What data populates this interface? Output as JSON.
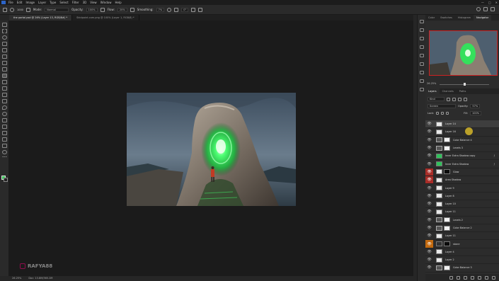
{
  "app": {
    "menu": [
      "File",
      "Edit",
      "Image",
      "Layer",
      "Type",
      "Select",
      "Filter",
      "3D",
      "View",
      "Window",
      "Help"
    ],
    "window_controls": [
      "—",
      "□",
      "✕"
    ]
  },
  "options": {
    "brush_size": "1000",
    "mode_label": "Mode:",
    "mode_value": "Normal",
    "opacity_label": "Opacity:",
    "opacity_value": "100%",
    "flow_label": "Flow:",
    "flow_value": "20%",
    "smoothing_label": "Smoothing:",
    "smoothing_value": "7%",
    "angle_value": "0°"
  },
  "tabs": [
    {
      "label": "the portal.psd @ 26% (Layer 13, RGB/8#) *",
      "active": true
    },
    {
      "label": "Skidpoint.com.png @ 100% (Layer 1, RGB/8) *",
      "active": false
    }
  ],
  "status": {
    "zoom": "26.25%",
    "doc": "Doc: 13.8M/365.2M"
  },
  "watermark": "RAFYA88",
  "panels": {
    "top_tabs": [
      "Color",
      "Swatches",
      "Histogram",
      "Navigator"
    ],
    "zoom": "26.25%",
    "layer_tabs": [
      "Layers",
      "Channels",
      "Paths"
    ],
    "kind": "Kind",
    "blend": "Screen",
    "opacity_label": "Opacity:",
    "opacity": "57%",
    "lock_label": "Lock:",
    "fill_label": "Fill:",
    "fill": "100%"
  },
  "layers": [
    {
      "name": "Layer 14",
      "thumb": "white",
      "mask": "",
      "vis": "eye",
      "sel": true
    },
    {
      "name": "Layer 16",
      "thumb": "white",
      "mask": "",
      "vis": "eye"
    },
    {
      "name": "Color Balance 4",
      "thumb": "adj",
      "mask": "white",
      "vis": "eye"
    },
    {
      "name": "Levels 3",
      "thumb": "adj",
      "mask": "white",
      "vis": "eye"
    },
    {
      "name": "Inner Extra Shadow copy",
      "thumb": "green",
      "mask": "",
      "vis": "eye",
      "fx": true
    },
    {
      "name": "Inner Extra Shadow",
      "thumb": "green",
      "mask": "",
      "vis": "eye",
      "fx": true
    },
    {
      "name": "Glow",
      "thumb": "white",
      "mask": "black",
      "vis": "red"
    },
    {
      "name": "Area Shadow",
      "thumb": "white",
      "mask": "",
      "vis": "red"
    },
    {
      "name": "Layer 9",
      "thumb": "white",
      "mask": "",
      "vis": "eye"
    },
    {
      "name": "Layer 8",
      "thumb": "white",
      "mask": "",
      "vis": "eye"
    },
    {
      "name": "Layer 10",
      "thumb": "white",
      "mask": "",
      "vis": "eye"
    },
    {
      "name": "Layer 11",
      "thumb": "white",
      "mask": "",
      "vis": "eye"
    },
    {
      "name": "Levels 2",
      "thumb": "adj",
      "mask": "white",
      "vis": "eye"
    },
    {
      "name": "Color Balance 2",
      "thumb": "adj",
      "mask": "white",
      "vis": "eye"
    },
    {
      "name": "Layer 11",
      "thumb": "white",
      "mask": "",
      "vis": "eye"
    },
    {
      "name": "stone",
      "thumb": "dark",
      "mask": "black",
      "vis": "orange"
    },
    {
      "name": "Layer 4",
      "thumb": "white",
      "mask": "",
      "vis": "eye"
    },
    {
      "name": "Layer 2",
      "thumb": "white",
      "mask": "",
      "vis": "eye"
    },
    {
      "name": "Color Balance 3",
      "thumb": "adj",
      "mask": "white",
      "vis": "eye"
    }
  ],
  "colors": {
    "accent_red": "#a82d28",
    "accent_orange": "#c26a10",
    "glow": "#3cff6a",
    "foreground": "#3cc85a"
  }
}
